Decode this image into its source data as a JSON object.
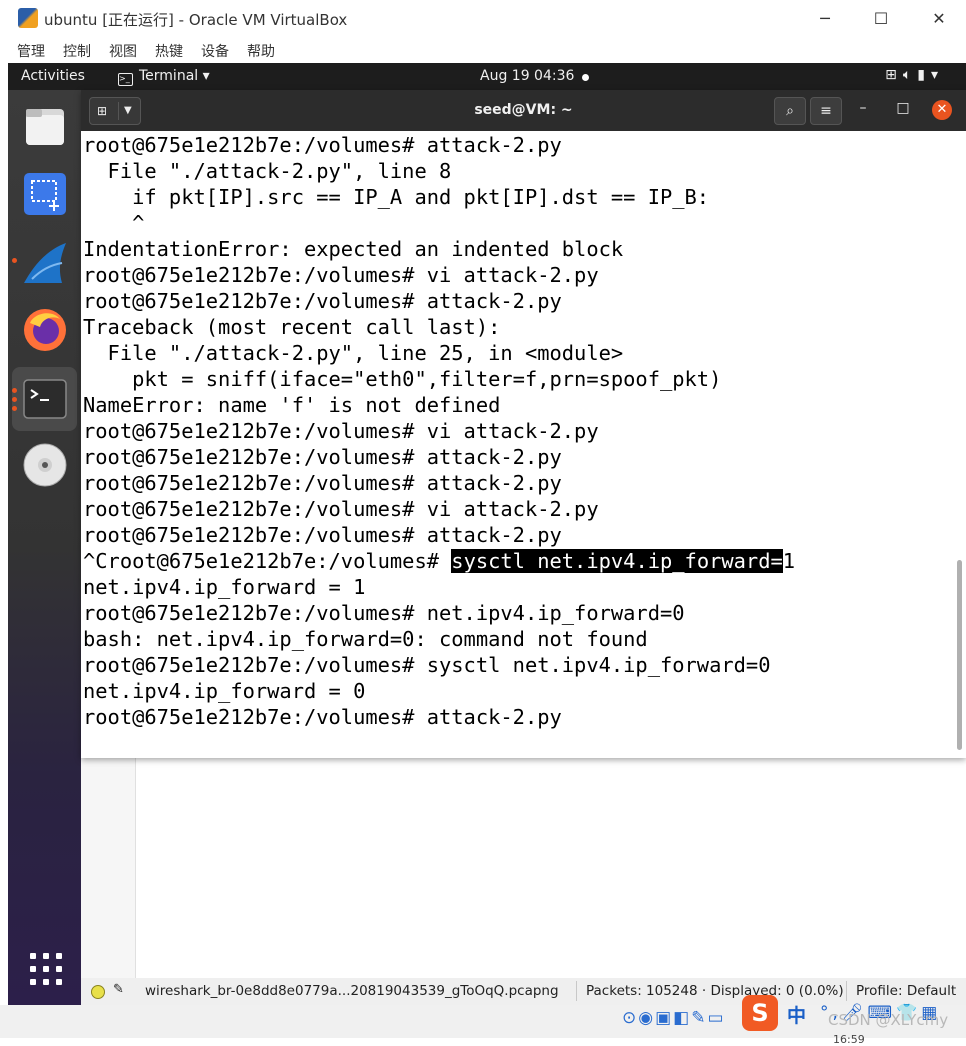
{
  "vbox": {
    "title": "ubuntu [正在运行] - Oracle VM VirtualBox",
    "menu": [
      "管理",
      "控制",
      "视图",
      "热键",
      "设备",
      "帮助"
    ],
    "controls": {
      "minimize": "─",
      "maximize": "☐",
      "close": "✕"
    }
  },
  "topbar": {
    "activities": "Activities",
    "app_menu": "Terminal ▾",
    "clock": "Aug 19  04:36",
    "tray_icons": [
      "network-icon",
      "volume-icon",
      "battery-icon",
      "power-menu-icon"
    ]
  },
  "dock": {
    "apps": [
      "files-icon",
      "screenshot-icon",
      "wireshark-icon",
      "firefox-icon",
      "terminal-icon",
      "dvd-icon"
    ]
  },
  "terminal": {
    "title": "seed@VM: ~",
    "lines": [
      "root@675e1e212b7e:/volumes# attack-2.py",
      "  File \"./attack-2.py\", line 8",
      "    if pkt[IP].src == IP_A and pkt[IP].dst == IP_B:",
      "    ^",
      "IndentationError: expected an indented block",
      "root@675e1e212b7e:/volumes# vi attack-2.py",
      "root@675e1e212b7e:/volumes# attack-2.py",
      "Traceback (most recent call last):",
      "  File \"./attack-2.py\", line 25, in <module>",
      "    pkt = sniff(iface=\"eth0\",filter=f,prn=spoof_pkt)",
      "NameError: name 'f' is not defined",
      "root@675e1e212b7e:/volumes# vi attack-2.py",
      "root@675e1e212b7e:/volumes# attack-2.py",
      "root@675e1e212b7e:/volumes# attack-2.py",
      "root@675e1e212b7e:/volumes# vi attack-2.py",
      "root@675e1e212b7e:/volumes# attack-2.py"
    ],
    "selected_line": {
      "prefix": "^Croot@675e1e212b7e:/volumes# ",
      "selected": "sysctl net.ipv4.ip_forward=",
      "suffix": "1"
    },
    "lines_after": [
      "net.ipv4.ip_forward = 1",
      "root@675e1e212b7e:/volumes# net.ipv4.ip_forward=0",
      "bash: net.ipv4.ip_forward=0: command not found",
      "root@675e1e212b7e:/volumes# sysctl net.ipv4.ip_forward=0",
      "net.ipv4.ip_forward = 0",
      "root@675e1e212b7e:/volumes# attack-2.py"
    ]
  },
  "wireshark_status": {
    "filename": "wireshark_br-0e8dd8e0779a...20819043539_gToOqQ.pcapng",
    "packets": "Packets: 105248 · Displayed: 0 (0.0%)",
    "profile": "Profile: Default"
  },
  "host": {
    "ime_label": "S",
    "ime_lang": "中",
    "watermark": "CSDN @XLYcmy",
    "clock": "16:59"
  }
}
